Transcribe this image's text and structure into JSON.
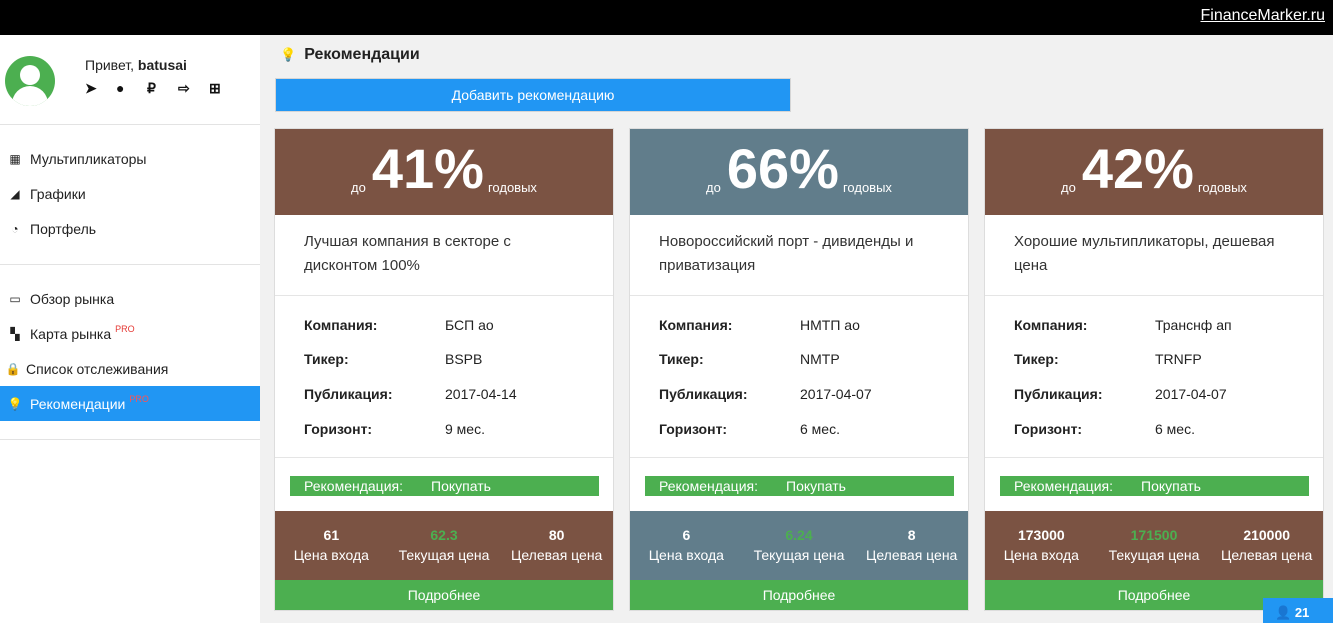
{
  "topbar": {
    "brand": "FinanceMarker.ru"
  },
  "user": {
    "greeting": "Привет,",
    "name": "batusai"
  },
  "user_icons": [
    "paper-plane-icon",
    "user-icon",
    "ruble-icon",
    "sign-out-icon",
    "plus-square-icon"
  ],
  "sidebar": {
    "items": [
      {
        "label": "Мультипликаторы",
        "icon": "calculator-icon",
        "glyph": "▦",
        "pro": ""
      },
      {
        "label": "Графики",
        "icon": "area-chart-icon",
        "glyph": "◢",
        "pro": ""
      },
      {
        "label": "Портфель",
        "icon": "pie-chart-icon",
        "glyph": "◔",
        "pro": ""
      },
      {
        "label": "Обзор рынка",
        "icon": "desktop-icon",
        "glyph": "▭",
        "pro": ""
      },
      {
        "label": "Карта рынка",
        "icon": "map-icon",
        "glyph": "▚",
        "pro": "PRO"
      },
      {
        "label": "Список отслеживания",
        "icon": "lock-icon",
        "glyph": "🔒",
        "pro": ""
      },
      {
        "label": "Рекомендации",
        "icon": "lightbulb-icon",
        "glyph": "💡",
        "pro": "PRO"
      }
    ]
  },
  "page": {
    "title": "Рекомендации",
    "add_button": "Добавить рекомендацию"
  },
  "cards": [
    {
      "prefix": "до",
      "percent": "41%",
      "suffix": "годовых",
      "headline": "Лучшая компания в секторе с дисконтом 100%",
      "company_label": "Компания:",
      "company": "БСП ао",
      "ticker_label": "Тикер:",
      "ticker": "BSPB",
      "pub_label": "Публикация:",
      "pub": "2017-04-14",
      "horizon_label": "Горизонт:",
      "horizon": "9 мес.",
      "rec_label": "Рекомендация:",
      "rec": "Покупать",
      "entry": "61",
      "entry_label": "Цена входа",
      "current": "62.3",
      "current_label": "Текущая цена",
      "target": "80",
      "target_label": "Целевая цена",
      "more": "Подробнее",
      "color": "#7b5343"
    },
    {
      "prefix": "до",
      "percent": "66%",
      "suffix": "годовых",
      "headline": "Новороссийский порт - дивиденды и приватизация",
      "company_label": "Компания:",
      "company": "НМТП ао",
      "ticker_label": "Тикер:",
      "ticker": "NMTP",
      "pub_label": "Публикация:",
      "pub": "2017-04-07",
      "horizon_label": "Горизонт:",
      "horizon": "6 мес.",
      "rec_label": "Рекомендация:",
      "rec": "Покупать",
      "entry": "6",
      "entry_label": "Цена входа",
      "current": "6.24",
      "current_label": "Текущая цена",
      "target": "8",
      "target_label": "Целевая цена",
      "more": "Подробнее",
      "color": "#617d8b"
    },
    {
      "prefix": "до",
      "percent": "42%",
      "suffix": "годовых",
      "headline": "Хорошие мультипликаторы, дешевая цена",
      "company_label": "Компания:",
      "company": "Транснф ап",
      "ticker_label": "Тикер:",
      "ticker": "TRNFP",
      "pub_label": "Публикация:",
      "pub": "2017-04-07",
      "horizon_label": "Горизонт:",
      "horizon": "6 мес.",
      "rec_label": "Рекомендация:",
      "rec": "Покупать",
      "entry": "173000",
      "entry_label": "Цена входа",
      "current": "171500",
      "current_label": "Текущая цена",
      "target": "210000",
      "target_label": "Целевая цена",
      "more": "Подробнее",
      "color": "#7b5343"
    }
  ],
  "online": {
    "icon": "user-icon",
    "count": "21"
  }
}
